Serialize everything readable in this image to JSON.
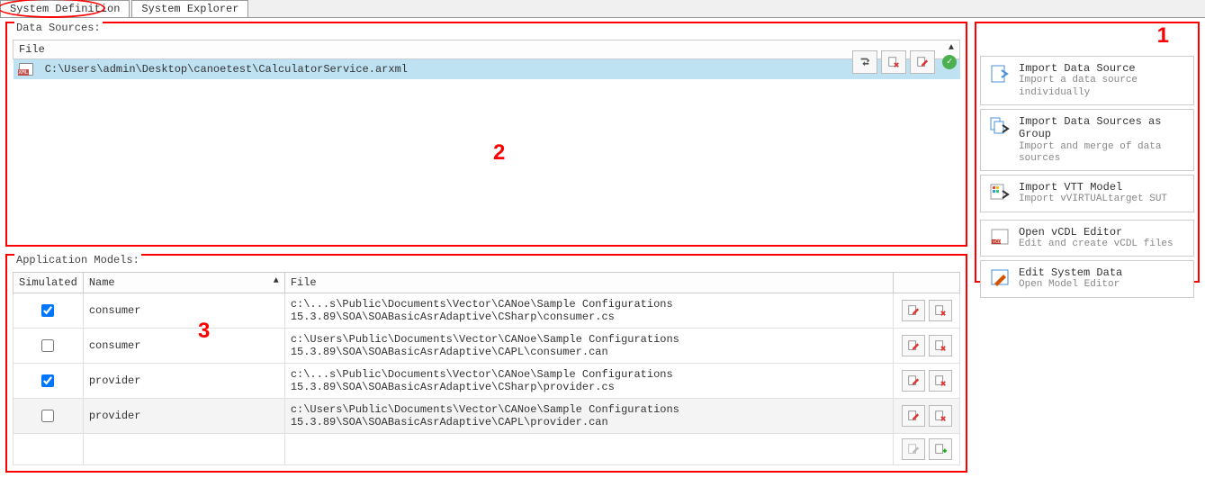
{
  "tabs": [
    {
      "label": "System Definition",
      "active": true
    },
    {
      "label": "System Explorer",
      "active": false
    }
  ],
  "annotations": {
    "a1": "1",
    "a2": "2",
    "a3": "3"
  },
  "data_sources": {
    "title": "Data Sources:",
    "header": "File",
    "row": {
      "path": "C:\\Users\\admin\\Desktop\\canoetest\\CalculatorService.arxml"
    }
  },
  "app_models": {
    "title": "Application Models:",
    "headers": {
      "sim": "Simulated",
      "name": "Name",
      "file": "File"
    },
    "rows": [
      {
        "simulated": true,
        "name": "consumer",
        "file": "c:\\...s\\Public\\Documents\\Vector\\CANoe\\Sample Configurations 15.3.89\\SOA\\SOABasicAsrAdaptive\\CSharp\\consumer.cs"
      },
      {
        "simulated": false,
        "name": "consumer",
        "file": "c:\\Users\\Public\\Documents\\Vector\\CANoe\\Sample Configurations 15.3.89\\SOA\\SOABasicAsrAdaptive\\CAPL\\consumer.can"
      },
      {
        "simulated": true,
        "name": "provider",
        "file": "c:\\...s\\Public\\Documents\\Vector\\CANoe\\Sample Configurations 15.3.89\\SOA\\SOABasicAsrAdaptive\\CSharp\\provider.cs"
      },
      {
        "simulated": false,
        "name": "provider",
        "file": "c:\\Users\\Public\\Documents\\Vector\\CANoe\\Sample Configurations 15.3.89\\SOA\\SOABasicAsrAdaptive\\CAPL\\provider.can"
      }
    ]
  },
  "right_actions": [
    {
      "title": "Import Data Source",
      "sub": "Import a data source individually"
    },
    {
      "title": "Import Data Sources as Group",
      "sub": "Import and merge of data sources"
    },
    {
      "title": "Import VTT Model",
      "sub": "Import vVIRTUALtarget SUT"
    },
    {
      "title": "Open vCDL Editor",
      "sub": "Edit and create vCDL files"
    },
    {
      "title": "Edit System Data",
      "sub": "Open Model Editor"
    }
  ]
}
